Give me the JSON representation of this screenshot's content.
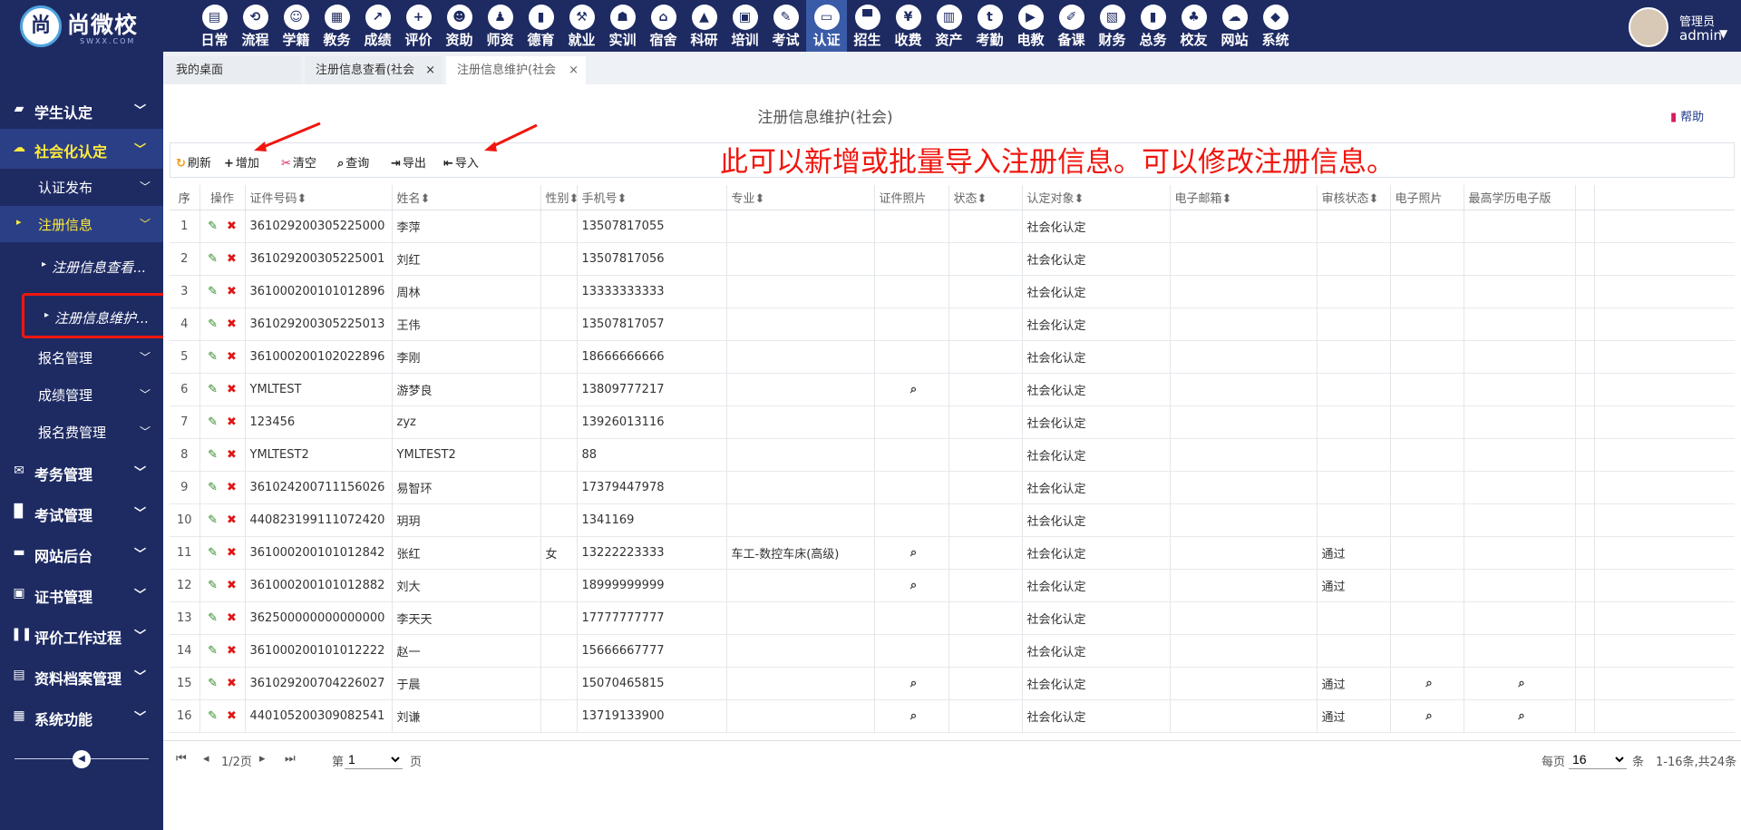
{
  "logo": {
    "mark": "尚",
    "name": "尚微校",
    "sub": "SWXX.COM"
  },
  "modules": [
    {
      "label": "日常",
      "icon": "document-icon"
    },
    {
      "label": "流程",
      "icon": "flow-icon"
    },
    {
      "label": "学籍",
      "icon": "student-icon"
    },
    {
      "label": "教务",
      "icon": "calendar-icon"
    },
    {
      "label": "成绩",
      "icon": "chart-icon"
    },
    {
      "label": "评价",
      "icon": "calendar-plus-icon"
    },
    {
      "label": "资助",
      "icon": "person-icon"
    },
    {
      "label": "师资",
      "icon": "teacher-icon"
    },
    {
      "label": "德育",
      "icon": "book-icon"
    },
    {
      "label": "就业",
      "icon": "hammer-icon"
    },
    {
      "label": "实训",
      "icon": "robot-icon"
    },
    {
      "label": "宿舍",
      "icon": "home-icon"
    },
    {
      "label": "科研",
      "icon": "graduation-cap-icon"
    },
    {
      "label": "培训",
      "icon": "image-icon"
    },
    {
      "label": "考试",
      "icon": "wrench-icon"
    },
    {
      "label": "认证",
      "icon": "monitor-icon"
    },
    {
      "label": "招生",
      "icon": "bus-icon"
    },
    {
      "label": "收费",
      "icon": "yen-icon"
    },
    {
      "label": "资产",
      "icon": "train-icon"
    },
    {
      "label": "考勤",
      "icon": "tumblr-icon"
    },
    {
      "label": "电教",
      "icon": "media-icon"
    },
    {
      "label": "备课",
      "icon": "edit-icon"
    },
    {
      "label": "财务",
      "icon": "newspaper-icon"
    },
    {
      "label": "总务",
      "icon": "bar-chart-icon"
    },
    {
      "label": "校友",
      "icon": "group-icon"
    },
    {
      "label": "网站",
      "icon": "cloud-icon"
    },
    {
      "label": "系统",
      "icon": "cube-icon"
    }
  ],
  "user": {
    "role": "管理员",
    "name": "admin"
  },
  "sidebar": {
    "groups": [
      {
        "label": "学生认定",
        "icon": "book-icon"
      },
      {
        "label": "社会化认定",
        "icon": "cloud-icon"
      },
      {
        "label": "考务管理",
        "icon": "envelope-icon"
      },
      {
        "label": "考试管理",
        "icon": "file-icon"
      },
      {
        "label": "网站后台",
        "icon": "folder-icon"
      },
      {
        "label": "证书管理",
        "icon": "certificate-icon"
      },
      {
        "label": "评价工作过程",
        "icon": "columns-icon"
      },
      {
        "label": "资料档案管理",
        "icon": "archive-icon"
      },
      {
        "label": "系统功能",
        "icon": "grid-icon"
      }
    ],
    "subs": {
      "publish": "认证发布",
      "register": "注册信息",
      "signup": "报名管理",
      "score": "成绩管理",
      "fee": "报名费管理"
    },
    "thirds": {
      "view": "注册信息查看...",
      "maintain": "注册信息维护..."
    }
  },
  "tabs": [
    {
      "label": "我的桌面",
      "close": ""
    },
    {
      "label": "注册信息查看(社会",
      "close": "×"
    },
    {
      "label": "注册信息维护(社会",
      "close": "×"
    }
  ],
  "page": {
    "title": "注册信息维护(社会)",
    "help": "帮助"
  },
  "toolbar": {
    "refresh": "刷新",
    "add": "增加",
    "clear": "清空",
    "query": "查询",
    "export": "导出",
    "import": "导入"
  },
  "annotation": "此可以新增或批量导入注册信息。可以修改注册信息。",
  "table": {
    "headers": [
      "序",
      "操作",
      "证件号码",
      "姓名",
      "性别",
      "手机号",
      "专业",
      "证件照片",
      "状态",
      "认定对象",
      "电子邮箱",
      "审核状态",
      "电子照片",
      "最高学历电子版"
    ],
    "rows": [
      {
        "no": "1",
        "id": "361029200305225000",
        "name": "李萍",
        "gender": "",
        "phone": "13507817055",
        "major": "",
        "photo": false,
        "status": "",
        "target": "社会化认定",
        "email": "",
        "audit": "",
        "ephoto": false,
        "edu": false
      },
      {
        "no": "2",
        "id": "361029200305225001",
        "name": "刘红",
        "gender": "",
        "phone": "13507817056",
        "major": "",
        "photo": false,
        "status": "",
        "target": "社会化认定",
        "email": "",
        "audit": "",
        "ephoto": false,
        "edu": false
      },
      {
        "no": "3",
        "id": "361000200101012896",
        "name": "周林",
        "gender": "",
        "phone": "13333333333",
        "major": "",
        "photo": false,
        "status": "",
        "target": "社会化认定",
        "email": "",
        "audit": "",
        "ephoto": false,
        "edu": false
      },
      {
        "no": "4",
        "id": "361029200305225013",
        "name": "王伟",
        "gender": "",
        "phone": "13507817057",
        "major": "",
        "photo": false,
        "status": "",
        "target": "社会化认定",
        "email": "",
        "audit": "",
        "ephoto": false,
        "edu": false
      },
      {
        "no": "5",
        "id": "361000200102022896",
        "name": "李刚",
        "gender": "",
        "phone": "18666666666",
        "major": "",
        "photo": false,
        "status": "",
        "target": "社会化认定",
        "email": "",
        "audit": "",
        "ephoto": false,
        "edu": false
      },
      {
        "no": "6",
        "id": "YMLTEST",
        "name": "游梦良",
        "gender": "",
        "phone": "13809777217",
        "major": "",
        "photo": true,
        "status": "",
        "target": "社会化认定",
        "email": "",
        "audit": "",
        "ephoto": false,
        "edu": false
      },
      {
        "no": "7",
        "id": "123456",
        "name": "zyz",
        "gender": "",
        "phone": "13926013116",
        "major": "",
        "photo": false,
        "status": "",
        "target": "社会化认定",
        "email": "",
        "audit": "",
        "ephoto": false,
        "edu": false
      },
      {
        "no": "8",
        "id": "YMLTEST2",
        "name": "YMLTEST2",
        "gender": "",
        "phone": "88",
        "major": "",
        "photo": false,
        "status": "",
        "target": "社会化认定",
        "email": "",
        "audit": "",
        "ephoto": false,
        "edu": false
      },
      {
        "no": "9",
        "id": "361024200711156026",
        "name": "易智环",
        "gender": "",
        "phone": "17379447978",
        "major": "",
        "photo": false,
        "status": "",
        "target": "社会化认定",
        "email": "",
        "audit": "",
        "ephoto": false,
        "edu": false
      },
      {
        "no": "10",
        "id": "440823199111072420",
        "name": "玥玥",
        "gender": "",
        "phone": "1341169",
        "major": "",
        "photo": false,
        "status": "",
        "target": "社会化认定",
        "email": "",
        "audit": "",
        "ephoto": false,
        "edu": false
      },
      {
        "no": "11",
        "id": "361000200101012842",
        "name": "张红",
        "gender": "女",
        "phone": "13222223333",
        "major": "车工-数控车床(高级)",
        "photo": true,
        "status": "",
        "target": "社会化认定",
        "email": "",
        "audit": "通过",
        "ephoto": false,
        "edu": false
      },
      {
        "no": "12",
        "id": "361000200101012882",
        "name": "刘大",
        "gender": "",
        "phone": "18999999999",
        "major": "",
        "photo": true,
        "status": "",
        "target": "社会化认定",
        "email": "",
        "audit": "通过",
        "ephoto": false,
        "edu": false
      },
      {
        "no": "13",
        "id": "362500000000000000",
        "name": "李天天",
        "gender": "",
        "phone": "17777777777",
        "major": "",
        "photo": false,
        "status": "",
        "target": "社会化认定",
        "email": "",
        "audit": "",
        "ephoto": false,
        "edu": false
      },
      {
        "no": "14",
        "id": "361000200101012222",
        "name": "赵一",
        "gender": "",
        "phone": "15666667777",
        "major": "",
        "photo": false,
        "status": "",
        "target": "社会化认定",
        "email": "",
        "audit": "",
        "ephoto": false,
        "edu": false
      },
      {
        "no": "15",
        "id": "361029200704226027",
        "name": "于晨",
        "gender": "",
        "phone": "15070465815",
        "major": "",
        "photo": true,
        "status": "",
        "target": "社会化认定",
        "email": "",
        "audit": "通过",
        "ephoto": true,
        "edu": true
      },
      {
        "no": "16",
        "id": "440105200309082541",
        "name": "刘谦",
        "gender": "",
        "phone": "13719133900",
        "major": "",
        "photo": true,
        "status": "",
        "target": "社会化认定",
        "email": "",
        "audit": "通过",
        "ephoto": true,
        "edu": true
      }
    ]
  },
  "pager": {
    "pages": "1/2页",
    "page_prefix": "第",
    "page_value": "1",
    "page_suffix": "页",
    "per_page_label": "每页",
    "per_page_value": "16",
    "per_page_unit": "条",
    "summary": "1-16条,共24条"
  },
  "colors": {
    "nav_bg": "#1e2b63",
    "active_module": "#3a5ba8",
    "active_sidebar_text": "#ffeb3b",
    "annotation": "#f0160e",
    "edit": "#2e8b23",
    "delete": "#e01616"
  }
}
